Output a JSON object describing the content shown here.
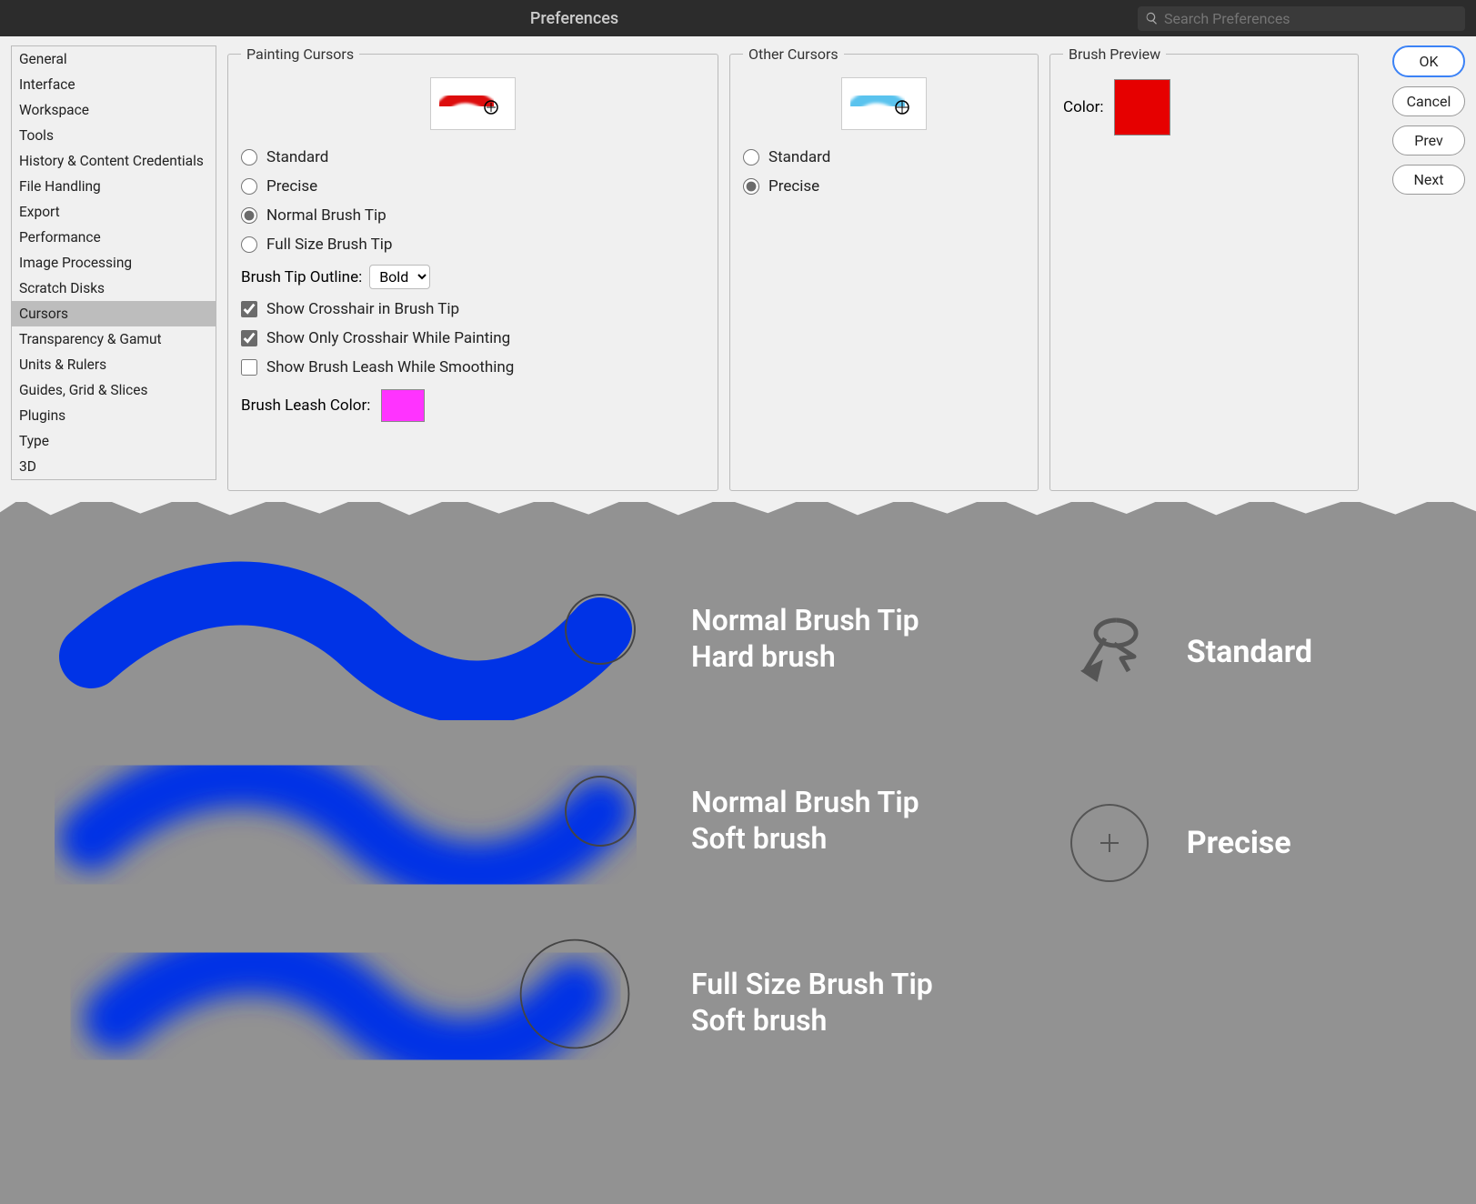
{
  "titlebar": {
    "title": "Preferences",
    "search_placeholder": "Search Preferences"
  },
  "sidebar": {
    "items": [
      "General",
      "Interface",
      "Workspace",
      "Tools",
      "History & Content Credentials",
      "File Handling",
      "Export",
      "Performance",
      "Image Processing",
      "Scratch Disks",
      "Cursors",
      "Transparency & Gamut",
      "Units & Rulers",
      "Guides, Grid & Slices",
      "Plugins",
      "Type",
      "3D"
    ],
    "selected_index": 10
  },
  "painting": {
    "legend": "Painting Cursors",
    "options": [
      "Standard",
      "Precise",
      "Normal Brush Tip",
      "Full Size Brush Tip"
    ],
    "selected_index": 2,
    "outline_label": "Brush Tip Outline:",
    "outline_value": "Bold",
    "check_crosshair": "Show Crosshair in Brush Tip",
    "check_only_crosshair": "Show Only Crosshair While Painting",
    "check_leash": "Show Brush Leash While Smoothing",
    "leash_label": "Brush Leash Color:",
    "leash_color": "#ff33ff"
  },
  "other": {
    "legend": "Other Cursors",
    "options": [
      "Standard",
      "Precise"
    ],
    "selected_index": 1
  },
  "preview": {
    "legend": "Brush Preview",
    "color_label": "Color:",
    "color": "#e60000"
  },
  "buttons": {
    "ok": "OK",
    "cancel": "Cancel",
    "prev": "Prev",
    "next": "Next"
  },
  "demo": {
    "rows": [
      {
        "line1": "Normal Brush Tip",
        "line2": "Hard brush"
      },
      {
        "line1": "Normal Brush Tip",
        "line2": "Soft brush"
      },
      {
        "line1": "Full Size Brush Tip",
        "line2": "Soft brush"
      }
    ],
    "samples": [
      "Standard",
      "Precise"
    ]
  }
}
